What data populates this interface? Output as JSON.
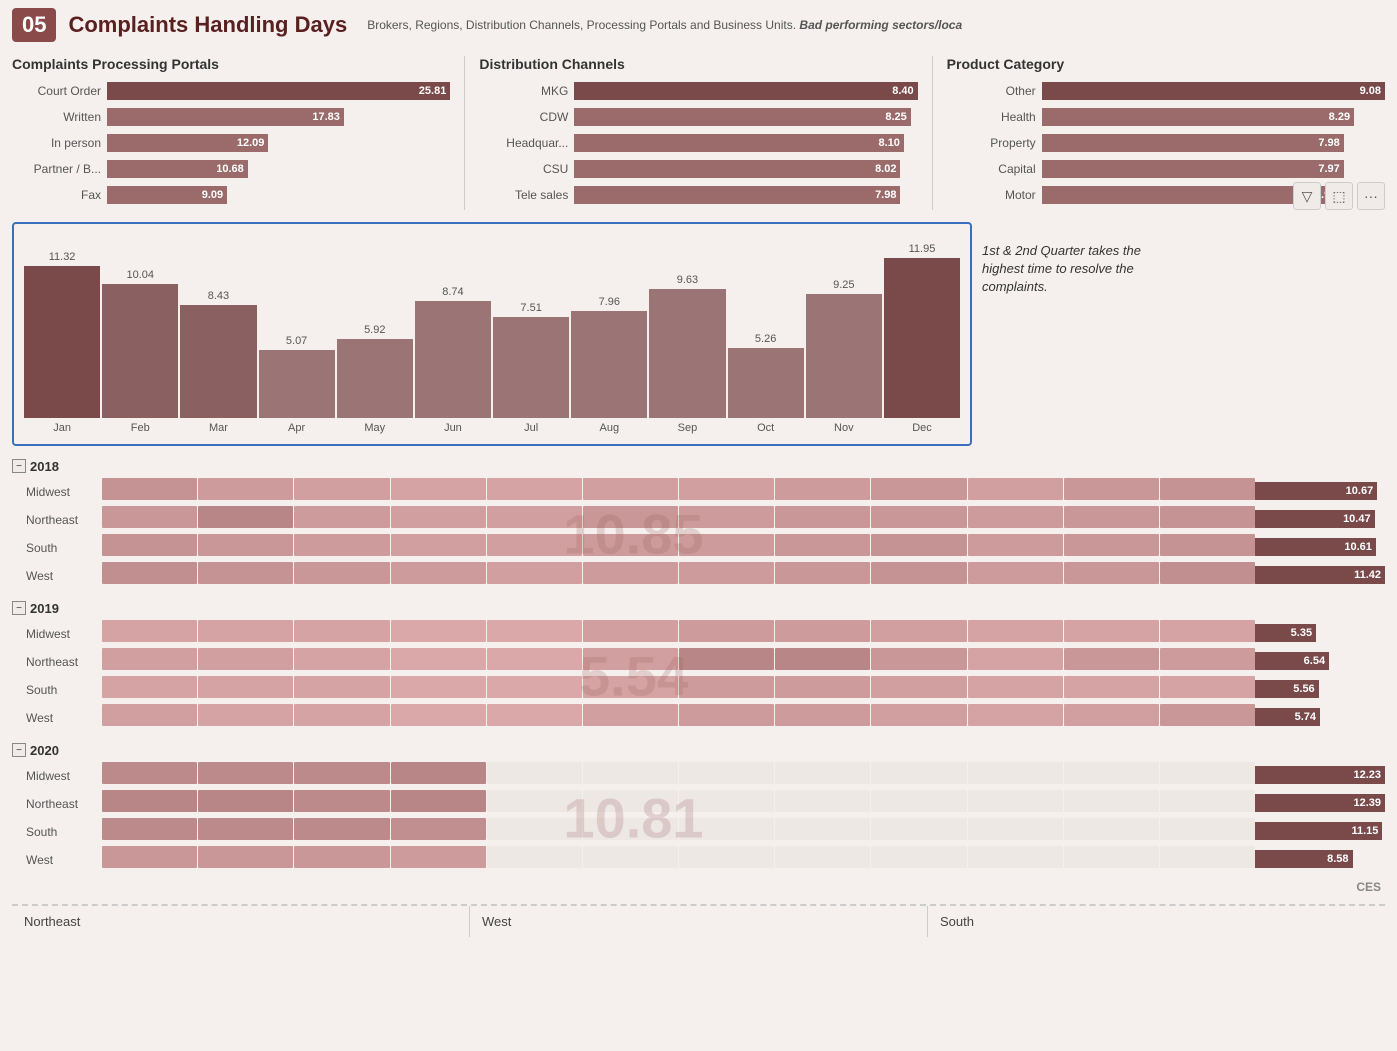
{
  "header": {
    "number": "05",
    "title": "Complaints Handling Days",
    "description": "Brokers, Regions, Distribution Channels, Processing Portals and Business Units.",
    "description_bold": "Bad performing sectors/loca"
  },
  "portals": {
    "title": "Complaints Processing Portals",
    "items": [
      {
        "label": "Court Order",
        "value": "25.81",
        "pct": 100
      },
      {
        "label": "Written",
        "value": "17.83",
        "pct": 69
      },
      {
        "label": "In person",
        "value": "12.09",
        "pct": 47
      },
      {
        "label": "Partner / B...",
        "value": "10.68",
        "pct": 41
      },
      {
        "label": "Fax",
        "value": "9.09",
        "pct": 35
      }
    ]
  },
  "distribution": {
    "title": "Distribution Channels",
    "items": [
      {
        "label": "MKG",
        "value": "8.40",
        "pct": 100
      },
      {
        "label": "CDW",
        "value": "8.25",
        "pct": 98
      },
      {
        "label": "Headquar...",
        "value": "8.10",
        "pct": 96
      },
      {
        "label": "CSU",
        "value": "8.02",
        "pct": 95
      },
      {
        "label": "Tele sales",
        "value": "7.98",
        "pct": 95
      }
    ]
  },
  "product": {
    "title": "Product Category",
    "items": [
      {
        "label": "Other",
        "value": "9.08",
        "pct": 100
      },
      {
        "label": "Health",
        "value": "8.29",
        "pct": 91
      },
      {
        "label": "Property",
        "value": "7.98",
        "pct": 88
      },
      {
        "label": "Capital",
        "value": "7.97",
        "pct": 88
      },
      {
        "label": "Motor",
        "value": "7.94",
        "pct": 87
      }
    ]
  },
  "monthly_chart": {
    "months": [
      {
        "label": "Jan",
        "value": 11.32,
        "display": "11.32",
        "pct": 95
      },
      {
        "label": "Feb",
        "value": 10.04,
        "display": "10.04",
        "pct": 84
      },
      {
        "label": "Mar",
        "value": 8.43,
        "display": "8.43",
        "pct": 71
      },
      {
        "label": "Apr",
        "value": 5.07,
        "display": "5.07",
        "pct": 43
      },
      {
        "label": "May",
        "value": 5.92,
        "display": "5.92",
        "pct": 50
      },
      {
        "label": "Jun",
        "value": 8.74,
        "display": "8.74",
        "pct": 73
      },
      {
        "label": "Jul",
        "value": 7.51,
        "display": "7.51",
        "pct": 63
      },
      {
        "label": "Aug",
        "value": 7.96,
        "display": "7.96",
        "pct": 67
      },
      {
        "label": "Sep",
        "value": 9.63,
        "display": "9.63",
        "pct": 81
      },
      {
        "label": "Oct",
        "value": 5.26,
        "display": "5.26",
        "pct": 44
      },
      {
        "label": "Nov",
        "value": 9.25,
        "display": "9.25",
        "pct": 78
      },
      {
        "label": "Dec",
        "value": 11.95,
        "display": "11.95",
        "pct": 100
      }
    ],
    "note": "1st & 2nd Quarter takes the highest time to resolve the complaints."
  },
  "years": [
    {
      "year": "2018",
      "watermark": "10.85",
      "regions": [
        {
          "name": "Midwest",
          "right_val": "10.67",
          "right_pct": 94
        },
        {
          "name": "Northeast",
          "right_val": "10.47",
          "right_pct": 92
        },
        {
          "name": "South",
          "right_val": "10.61",
          "right_pct": 93
        },
        {
          "name": "West",
          "right_val": "11.42",
          "right_pct": 100
        }
      ]
    },
    {
      "year": "2019",
      "watermark": "5.54",
      "regions": [
        {
          "name": "Midwest",
          "right_val": "5.35",
          "right_pct": 47
        },
        {
          "name": "Northeast",
          "right_val": "6.54",
          "right_pct": 57
        },
        {
          "name": "South",
          "right_val": "5.56",
          "right_pct": 49
        },
        {
          "name": "West",
          "right_val": "5.74",
          "right_pct": 50
        }
      ]
    },
    {
      "year": "2020",
      "watermark": "10.81",
      "regions": [
        {
          "name": "Midwest",
          "right_val": "12.23",
          "right_pct": 100
        },
        {
          "name": "Northeast",
          "right_val": "12.39",
          "right_pct": 100
        },
        {
          "name": "South",
          "right_val": "11.15",
          "right_pct": 98
        },
        {
          "name": "West",
          "right_val": "8.58",
          "right_pct": 75
        }
      ]
    }
  ],
  "bottom_tabs": [
    "Northeast",
    "West",
    "South"
  ],
  "ces_label": "CES",
  "action_buttons": [
    "filter-icon",
    "export-icon",
    "more-icon"
  ]
}
